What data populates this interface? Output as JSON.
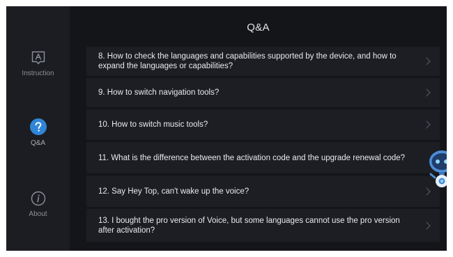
{
  "sidebar": {
    "items": [
      {
        "label": "Instruction",
        "icon": "instruction-icon",
        "active": false
      },
      {
        "label": "Q&A",
        "icon": "question-mark-icon",
        "active": true
      },
      {
        "label": "About",
        "icon": "info-icon",
        "active": false
      }
    ]
  },
  "main": {
    "title": "Q&A",
    "questions": [
      {
        "text": "8. How to check the languages and capabilities supported by the device, and how to expand the languages or capabilities?"
      },
      {
        "text": "9. How to switch navigation tools?"
      },
      {
        "text": "10. How to switch music tools?"
      },
      {
        "text": "11. What is the difference between the activation code and the upgrade renewal code?"
      },
      {
        "text": "12. Say Hey Top, can't wake up the voice?"
      },
      {
        "text": "13. I bought the pro version of Voice, but some languages cannot use the pro version after activation?"
      }
    ]
  },
  "assistant": {
    "icon": "robot-assistant-icon"
  },
  "colors": {
    "background": "#141519",
    "sidebar": "#1b1d22",
    "row": "#1c1e23",
    "accent": "#2f86d6",
    "text": "#e9eaed"
  }
}
